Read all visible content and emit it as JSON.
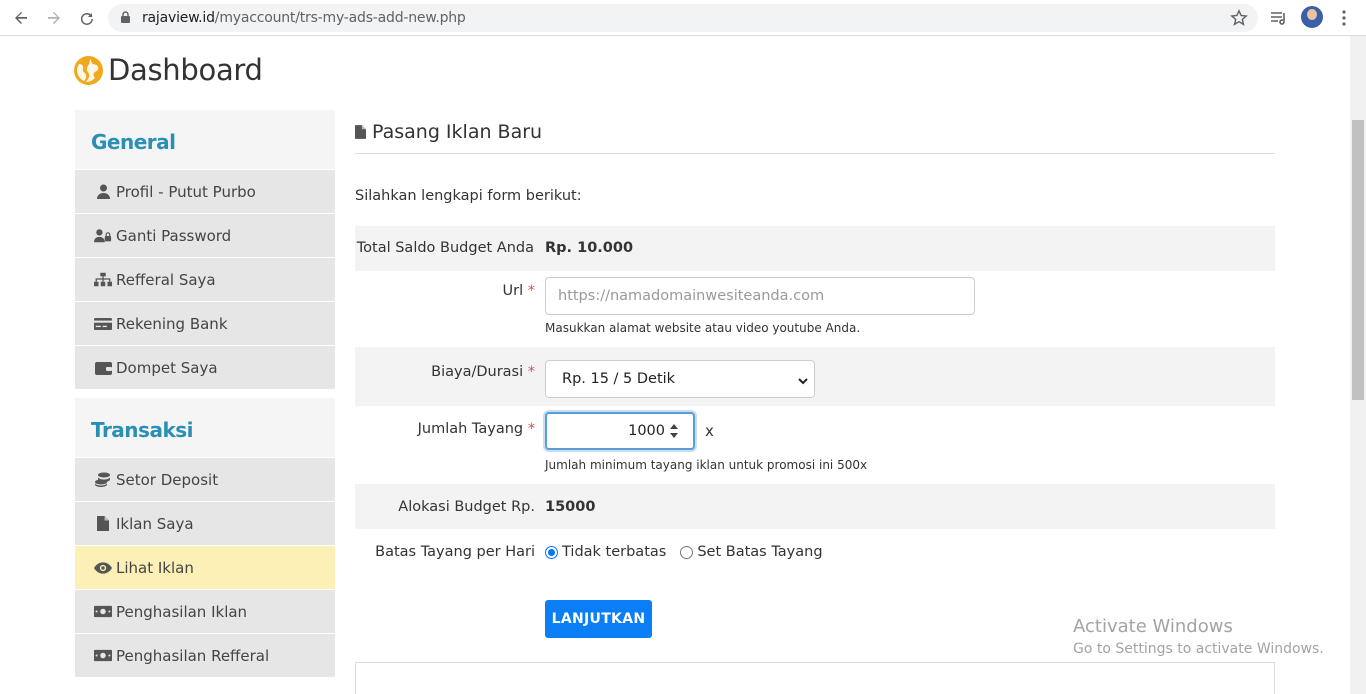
{
  "browser": {
    "url_domain": "rajaview.id",
    "url_path": "/myaccount/trs-my-ads-add-new.php"
  },
  "page_title": "Dashboard",
  "sidebar": {
    "general_heading": "General",
    "general_items": [
      {
        "label": "Profil - Putut Purbo",
        "icon": "user-icon"
      },
      {
        "label": "Ganti Password",
        "icon": "users-lock-icon"
      },
      {
        "label": "Refferal Saya",
        "icon": "sitemap-icon"
      },
      {
        "label": "Rekening Bank",
        "icon": "credit-card-icon"
      },
      {
        "label": "Dompet Saya",
        "icon": "wallet-icon"
      }
    ],
    "transaksi_heading": "Transaksi",
    "transaksi_items": [
      {
        "label": "Setor Deposit",
        "icon": "coins-icon"
      },
      {
        "label": "Iklan Saya",
        "icon": "file-icon"
      },
      {
        "label": "Lihat Iklan",
        "icon": "eye-icon",
        "active": true
      },
      {
        "label": "Penghasilan Iklan",
        "icon": "money-icon"
      },
      {
        "label": "Penghasilan Refferal",
        "icon": "money-icon"
      }
    ]
  },
  "main": {
    "title": "Pasang Iklan Baru",
    "intro": "Silahkan lengkapi form berikut:",
    "saldo_label": "Total Saldo Budget Anda",
    "saldo_value": "Rp. 10.000",
    "url_label": "Url",
    "url_placeholder": "https://namadomainwesiteanda.com",
    "url_help": "Masukkan alamat website atau video youtube Anda.",
    "biaya_label": "Biaya/Durasi",
    "biaya_value": "Rp. 15 / 5 Detik",
    "jumlah_label": "Jumlah Tayang",
    "jumlah_value": "1000",
    "jumlah_suffix": "x",
    "jumlah_help": "Jumlah minimum tayang iklan untuk promosi ini 500x",
    "alokasi_label": "Alokasi Budget Rp.",
    "alokasi_value": "15000",
    "batas_label": "Batas Tayang per Hari",
    "batas_options": [
      {
        "label": "Tidak terbatas",
        "selected": true
      },
      {
        "label": "Set Batas Tayang",
        "selected": false
      }
    ],
    "submit_label": "LANJUTKAN",
    "required_mark": "*"
  },
  "watermark": {
    "line1": "Activate Windows",
    "line2": "Go to Settings to activate Windows."
  },
  "colors": {
    "accent": "#0a7ff5",
    "heading": "#2a8fb5",
    "active_bg": "#fdf0b7",
    "globe": "#f0a81c"
  }
}
